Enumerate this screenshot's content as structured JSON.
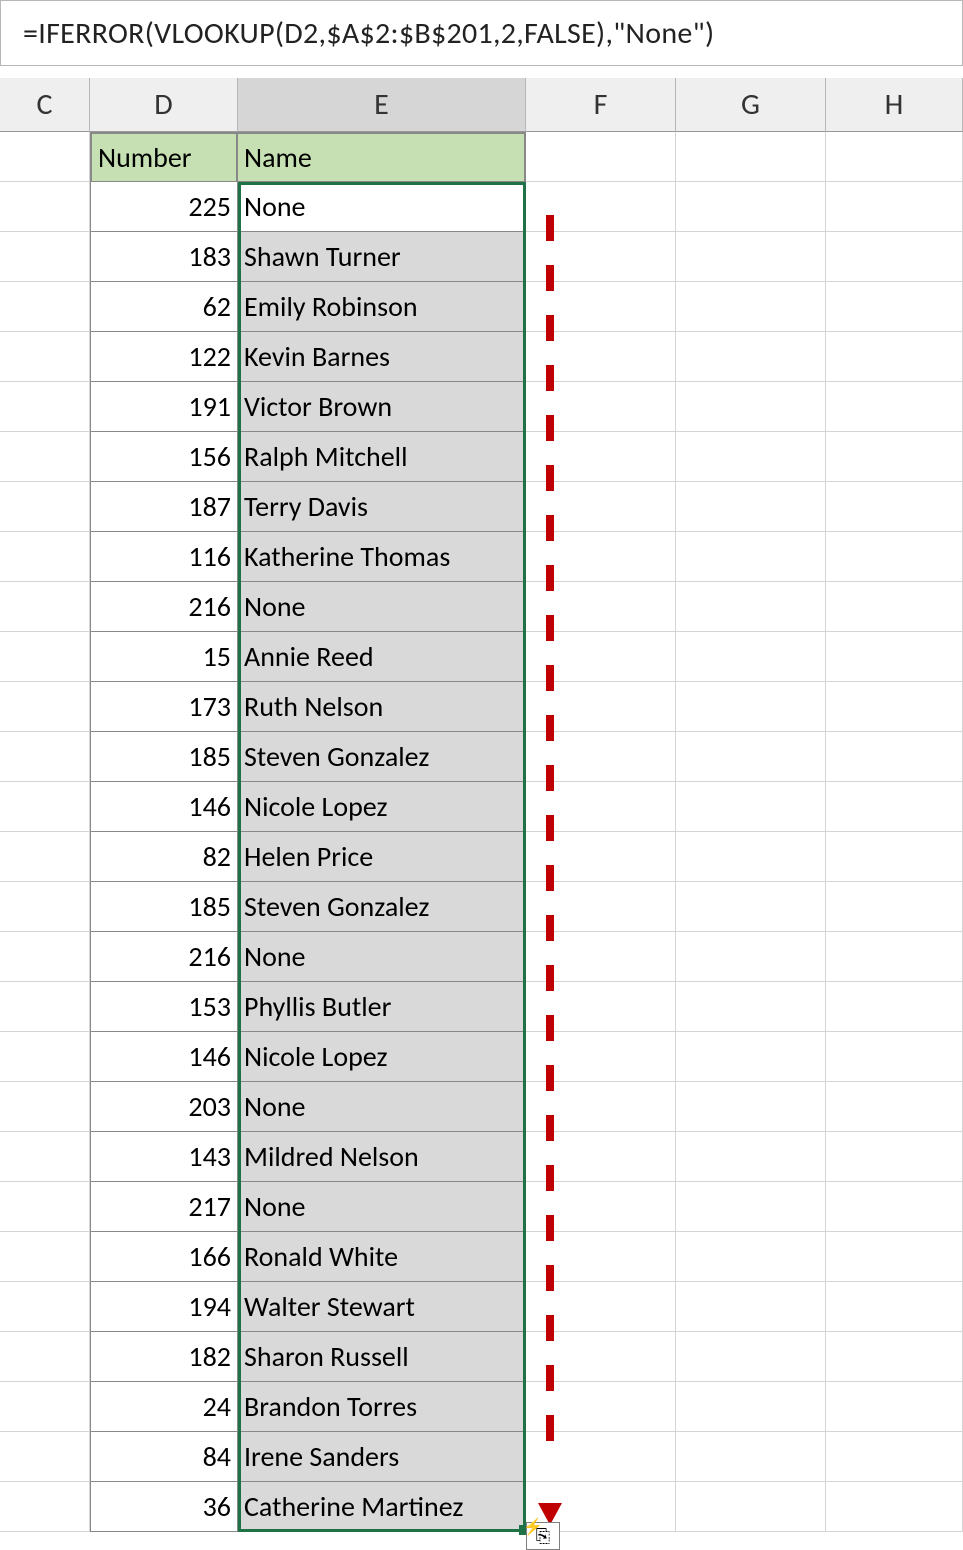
{
  "formula": "=IFERROR(VLOOKUP(D2,$A$2:$B$201,2,FALSE),\"None\")",
  "columns": [
    "C",
    "D",
    "E",
    "F",
    "G",
    "H"
  ],
  "selected_column": "E",
  "headers": {
    "D": "Number",
    "E": "Name"
  },
  "rows": [
    {
      "number": "225",
      "name": "None"
    },
    {
      "number": "183",
      "name": " Shawn Turner"
    },
    {
      "number": "62",
      "name": " Emily Robinson"
    },
    {
      "number": "122",
      "name": " Kevin Barnes"
    },
    {
      "number": "191",
      "name": " Victor Brown"
    },
    {
      "number": "156",
      "name": " Ralph Mitchell"
    },
    {
      "number": "187",
      "name": " Terry Davis"
    },
    {
      "number": "116",
      "name": " Katherine Thomas"
    },
    {
      "number": "216",
      "name": "None"
    },
    {
      "number": "15",
      "name": " Annie Reed"
    },
    {
      "number": "173",
      "name": " Ruth Nelson"
    },
    {
      "number": "185",
      "name": " Steven Gonzalez"
    },
    {
      "number": "146",
      "name": " Nicole Lopez"
    },
    {
      "number": "82",
      "name": " Helen Price"
    },
    {
      "number": "185",
      "name": " Steven Gonzalez"
    },
    {
      "number": "216",
      "name": "None"
    },
    {
      "number": "153",
      "name": " Phyllis Butler"
    },
    {
      "number": "146",
      "name": " Nicole Lopez"
    },
    {
      "number": "203",
      "name": "None"
    },
    {
      "number": "143",
      "name": " Mildred Nelson"
    },
    {
      "number": "217",
      "name": "None"
    },
    {
      "number": "166",
      "name": " Ronald White"
    },
    {
      "number": "194",
      "name": " Walter Stewart"
    },
    {
      "number": "182",
      "name": " Sharon Russell"
    },
    {
      "number": "24",
      "name": " Brandon Torres"
    },
    {
      "number": "84",
      "name": " Irene Sanders"
    },
    {
      "number": "36",
      "name": " Catherine Martinez"
    }
  ],
  "autofill_icon": "⎘",
  "autofill_bolt": "⚡"
}
